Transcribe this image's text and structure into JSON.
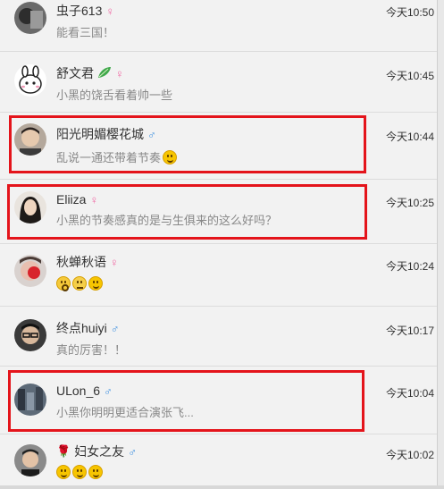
{
  "comments": [
    {
      "name": "虫子613",
      "gender": "♀",
      "time": "今天10:50",
      "text": "能看三国！"
    },
    {
      "name": "舒文君",
      "gender": "♀",
      "time": "今天10:45",
      "text": "小黑的饶舌看着帅一些"
    },
    {
      "name": "阳光明媚樱花城",
      "gender": "♂",
      "time": "今天10:44",
      "text": "乱说一通还带着节奏"
    },
    {
      "name": "Eliiza",
      "gender": "♀",
      "time": "今天10:25",
      "text": "小黑的节奏感真的是与生俱来的这么好吗？"
    },
    {
      "name": "秋蝉秋语",
      "gender": "♀",
      "time": "今天10:24",
      "text": ""
    },
    {
      "name": "终点huiyi",
      "gender": "♂",
      "time": "今天10:17",
      "text": "真的厉害！！"
    },
    {
      "name": "ULon_6",
      "gender": "♂",
      "time": "今天10:04",
      "text": "小黑你明明更适合演张飞..."
    },
    {
      "name": "妇女之友",
      "gender": "♂",
      "time": "今天10:02",
      "text": ""
    }
  ],
  "icons": {
    "female": "female-symbol-icon",
    "male": "male-symbol-icon",
    "emoji": "emoji-icon",
    "leaf": "leaf-icon",
    "rose": "rose-icon"
  },
  "colors": {
    "highlight": "#e4141b",
    "female": "#f06aa4",
    "male": "#3d8fe0"
  }
}
